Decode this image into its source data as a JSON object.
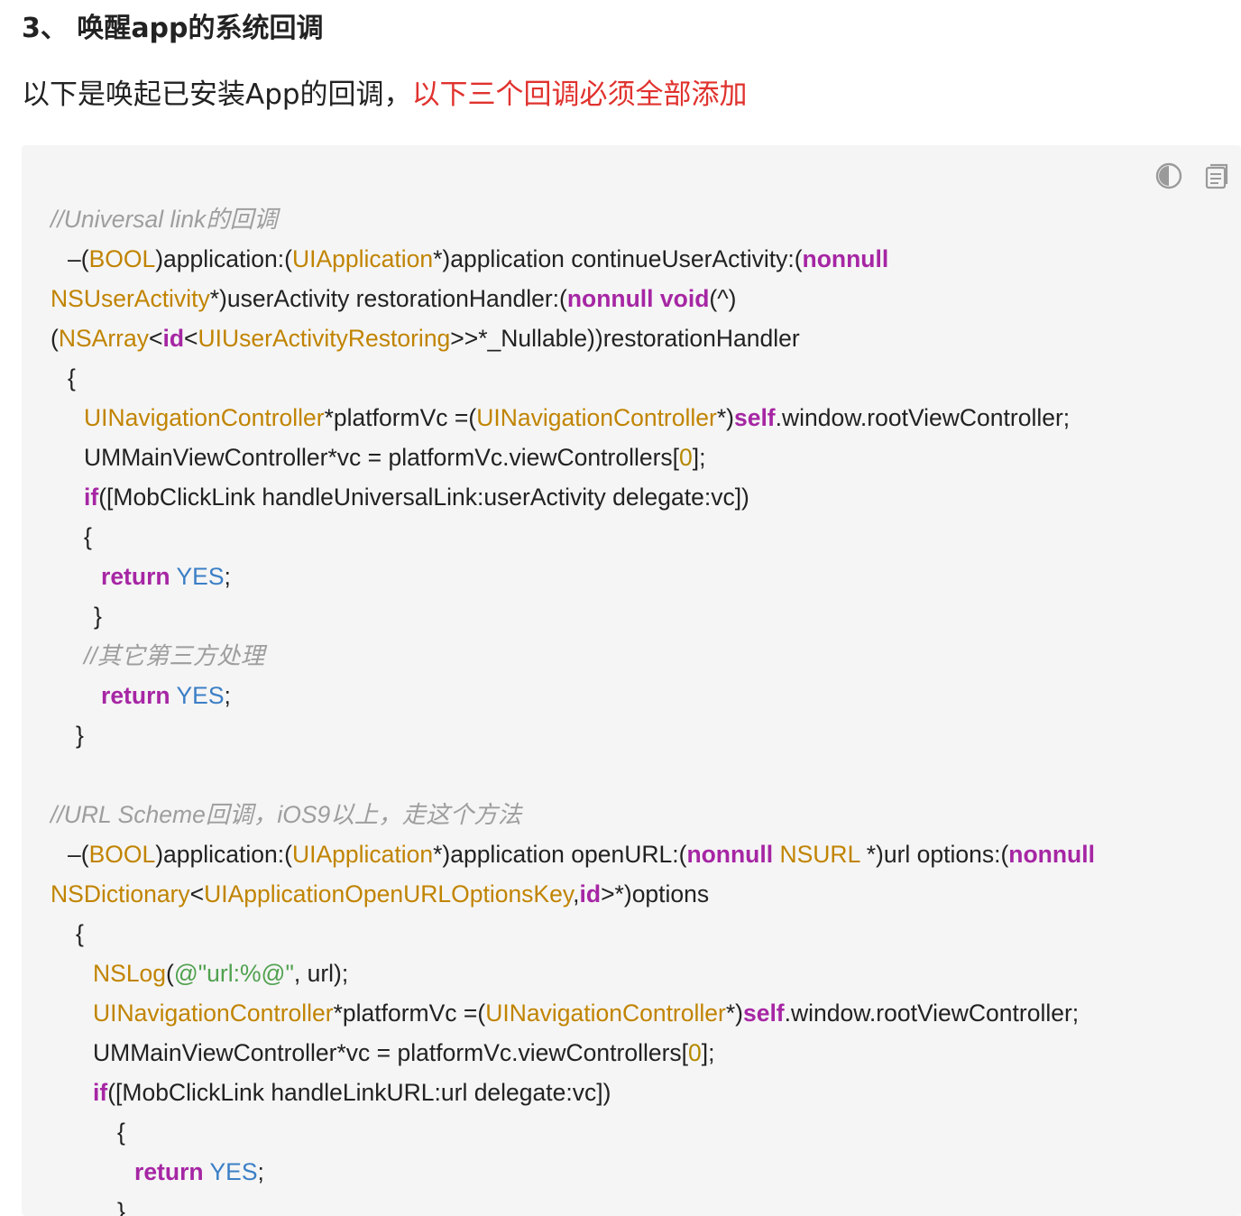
{
  "heading": "3、 唤醒app的系统回调",
  "intro": {
    "text": "以下是唤起已安装App的回调，",
    "warning": "以下三个回调必须全部添加"
  },
  "toolbar": {
    "theme_icon": "contrast-icon",
    "copy_icon": "copy-icon"
  },
  "colors": {
    "comment": "#9e9e9e",
    "type": "#c18401",
    "keyword": "#a626a4",
    "literal": "#3b7fc6",
    "number": "#b58900",
    "string": "#50a14f",
    "warning": "#e0322e",
    "code_bg": "#f5f5f5"
  },
  "code_lines": [
    [
      [
        "c",
        "//Universal link的回调"
      ]
    ],
    [
      [
        "p",
        "–("
      ],
      [
        "t",
        "BOOL"
      ],
      [
        "p",
        ")application:("
      ],
      [
        "t",
        "UIApplication"
      ],
      [
        "p",
        "*)application continueUserActivity:("
      ],
      [
        "k",
        "nonnull"
      ]
    ],
    [
      [
        "t",
        "NSUserActivity"
      ],
      [
        "p",
        "*)userActivity restorationHandler:("
      ],
      [
        "k",
        "nonnull"
      ],
      [
        "p",
        " "
      ],
      [
        "k",
        "void"
      ],
      [
        "p",
        "(^)"
      ]
    ],
    [
      [
        "p",
        "("
      ],
      [
        "t",
        "NSArray"
      ],
      [
        "p",
        "<"
      ],
      [
        "k",
        "id"
      ],
      [
        "p",
        "<"
      ],
      [
        "t",
        "UIUserActivityRestoring"
      ],
      [
        "p",
        ">>*_Nullable))restorationHandler"
      ]
    ],
    [
      [
        "p",
        "{"
      ]
    ],
    [
      [
        "t",
        "UINavigationController"
      ],
      [
        "p",
        "*platformVc =("
      ],
      [
        "t",
        "UINavigationController"
      ],
      [
        "p",
        "*)"
      ],
      [
        "k",
        "self"
      ],
      [
        "p",
        ".window.rootViewController;"
      ]
    ],
    [
      [
        "p",
        "UMMainViewController*vc = platformVc.viewControllers["
      ],
      [
        "n",
        "0"
      ],
      [
        "p",
        "];"
      ]
    ],
    [
      [
        "k",
        "if"
      ],
      [
        "p",
        "([MobClickLink handleUniversalLink:userActivity delegate:vc])"
      ]
    ],
    [
      [
        "p",
        "{"
      ]
    ],
    [
      [
        "k",
        "return"
      ],
      [
        "p",
        " "
      ],
      [
        "l",
        "YES"
      ],
      [
        "p",
        ";"
      ]
    ],
    [
      [
        "p",
        "}"
      ]
    ],
    [
      [
        "c",
        "//其它第三方处理"
      ]
    ],
    [
      [
        "k",
        "return"
      ],
      [
        "p",
        " "
      ],
      [
        "l",
        "YES"
      ],
      [
        "p",
        ";"
      ]
    ],
    [
      [
        "p",
        "}"
      ]
    ],
    [],
    [
      [
        "c",
        "//URL Scheme回调，iOS9以上，走这个方法"
      ]
    ],
    [
      [
        "p",
        "–("
      ],
      [
        "t",
        "BOOL"
      ],
      [
        "p",
        ")application:("
      ],
      [
        "t",
        "UIApplication"
      ],
      [
        "p",
        "*)application openURL:("
      ],
      [
        "k",
        "nonnull"
      ],
      [
        "p",
        " "
      ],
      [
        "t",
        "NSURL"
      ],
      [
        "p",
        " *)url options:("
      ],
      [
        "k",
        "nonnull"
      ]
    ],
    [
      [
        "t",
        "NSDictionary"
      ],
      [
        "p",
        "<"
      ],
      [
        "t",
        "UIApplicationOpenURLOptionsKey"
      ],
      [
        "p",
        ","
      ],
      [
        "k",
        "id"
      ],
      [
        "p",
        ">*)options"
      ]
    ],
    [
      [
        "p",
        "{"
      ]
    ],
    [
      [
        "t",
        "NSLog"
      ],
      [
        "p",
        "("
      ],
      [
        "s",
        "@\"url:%@\""
      ],
      [
        "p",
        ", url);"
      ]
    ],
    [
      [
        "t",
        "UINavigationController"
      ],
      [
        "p",
        "*platformVc =("
      ],
      [
        "t",
        "UINavigationController"
      ],
      [
        "p",
        "*)"
      ],
      [
        "k",
        "self"
      ],
      [
        "p",
        ".window.rootViewController;"
      ]
    ],
    [
      [
        "p",
        "UMMainViewController*vc = platformVc.viewControllers["
      ],
      [
        "n",
        "0"
      ],
      [
        "p",
        "];"
      ]
    ],
    [
      [
        "k",
        "if"
      ],
      [
        "p",
        "([MobClickLink handleLinkURL:url delegate:vc])"
      ]
    ],
    [
      [
        "p",
        "{"
      ]
    ],
    [
      [
        "k",
        "return"
      ],
      [
        "p",
        " "
      ],
      [
        "l",
        "YES"
      ],
      [
        "p",
        ";"
      ]
    ],
    [
      [
        "p",
        "}"
      ]
    ]
  ]
}
